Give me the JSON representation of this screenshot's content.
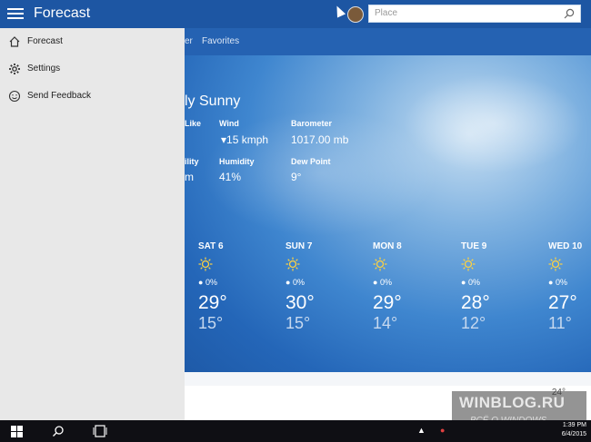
{
  "app": {
    "title": "Forecast"
  },
  "search": {
    "placeholder": "Place"
  },
  "tabs": [
    {
      "label": "er"
    },
    {
      "label": "Favorites"
    }
  ],
  "drawer": {
    "items": [
      {
        "label": "Forecast",
        "icon": "home-icon"
      },
      {
        "label": "Settings",
        "icon": "gear-icon"
      },
      {
        "label": "Send Feedback",
        "icon": "smiley-icon"
      }
    ]
  },
  "current": {
    "condition": "ly Sunny",
    "feels_like_label": "Like",
    "wind_label": "Wind",
    "wind_value": "15 kmph",
    "barometer_label": "Barometer",
    "barometer_value": "1017.00 mb",
    "visibility_label": "ility",
    "visibility_value": "m",
    "humidity_label": "Humidity",
    "humidity_value": "41%",
    "dewpoint_label": "Dew Point",
    "dewpoint_value": "9°"
  },
  "forecast": [
    {
      "day": "SAT 6",
      "precip": "0%",
      "hi": "29°",
      "lo": "15°"
    },
    {
      "day": "SUN 7",
      "precip": "0%",
      "hi": "30°",
      "lo": "15°"
    },
    {
      "day": "MON 8",
      "precip": "0%",
      "hi": "29°",
      "lo": "14°"
    },
    {
      "day": "TUE 9",
      "precip": "0%",
      "hi": "28°",
      "lo": "12°"
    },
    {
      "day": "WED 10",
      "precip": "0%",
      "hi": "27°",
      "lo": "11°"
    }
  ],
  "strip": {
    "temp": "24°"
  },
  "taskbar": {
    "time": "1:39 PM",
    "date": "6/4/2015"
  },
  "watermark": {
    "line1": "WINBLOG.RU",
    "line2": "ВСЁ О WINDOWS"
  },
  "colors": {
    "accent": "#1d56a3",
    "drawer_bg": "#e8e8e8",
    "taskbar": "#0f0f14"
  }
}
